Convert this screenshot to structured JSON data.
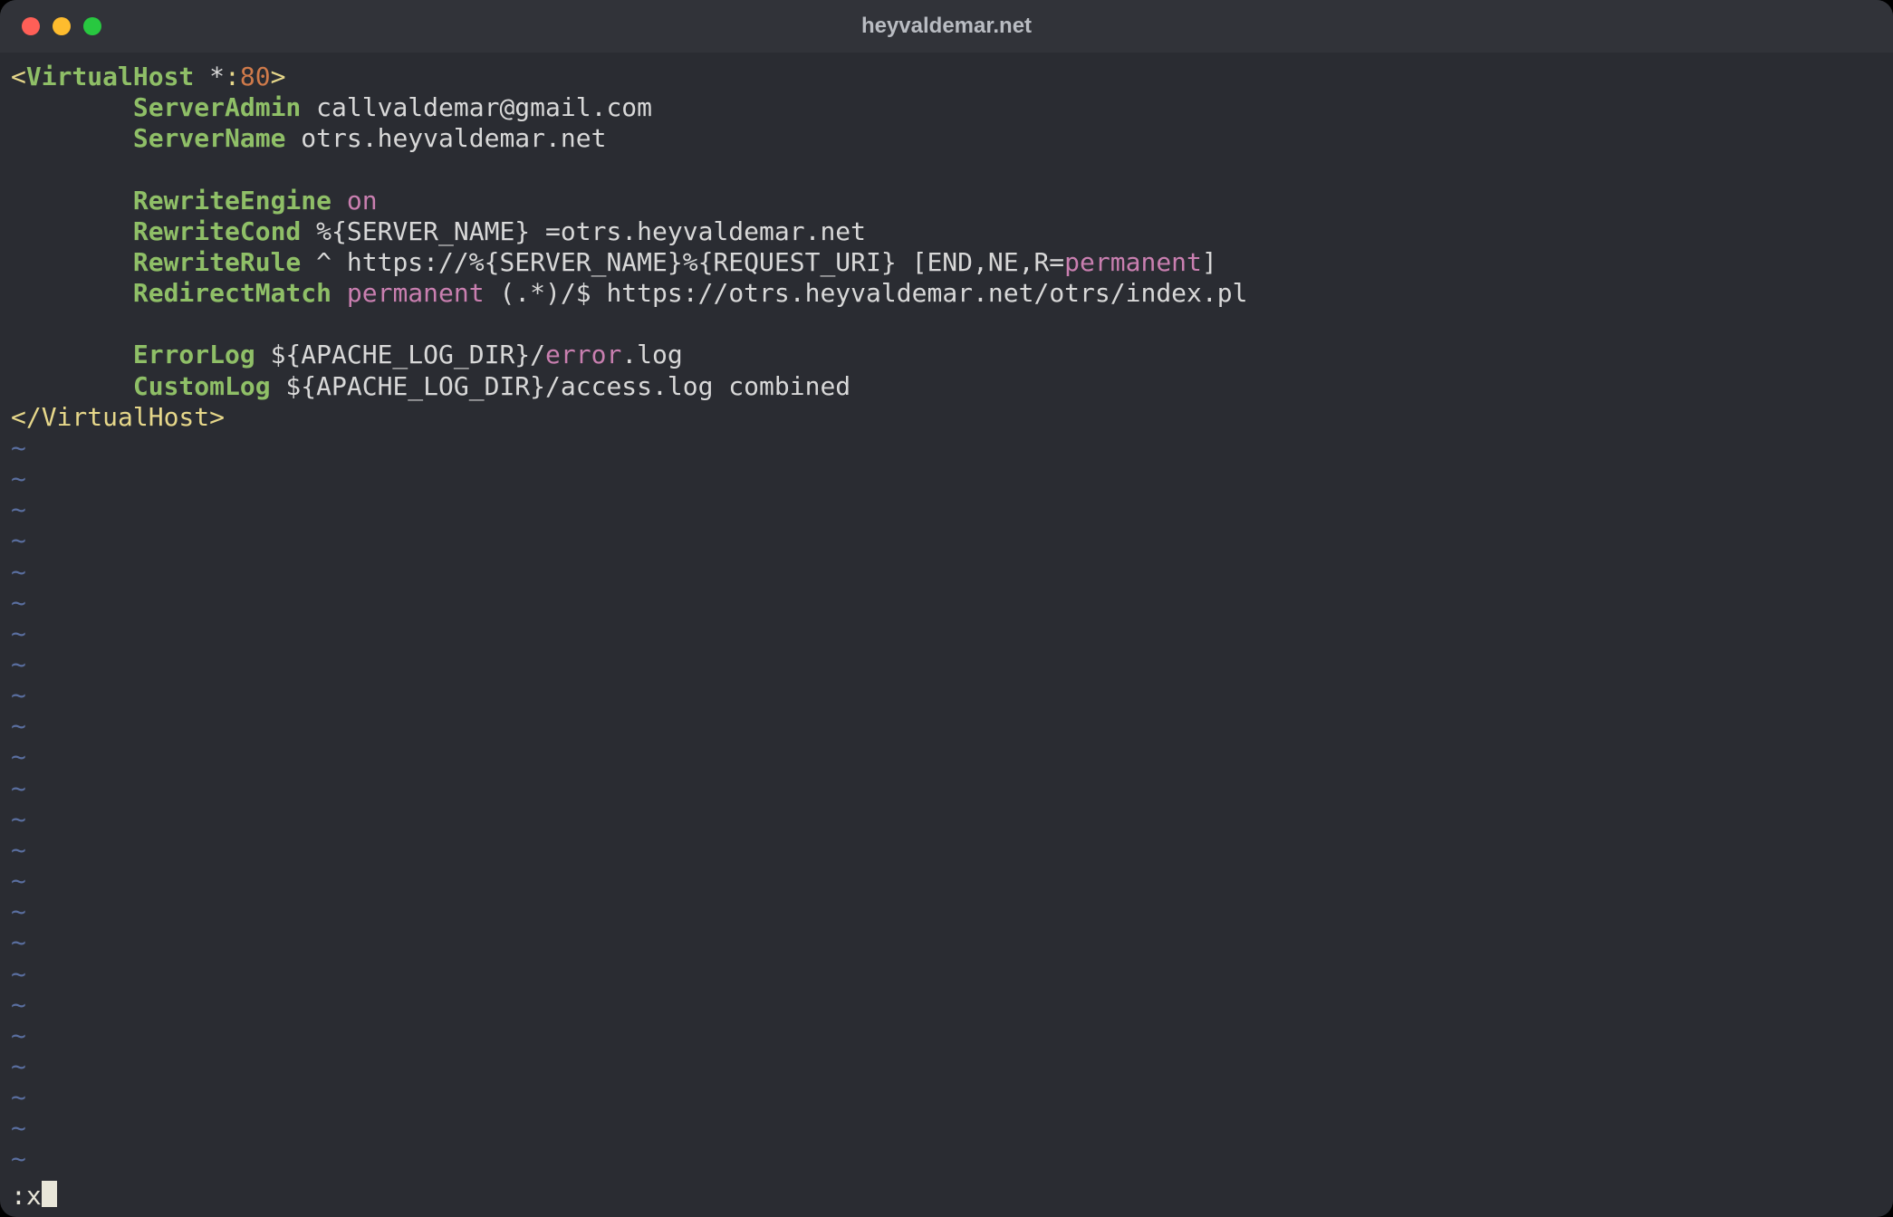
{
  "window": {
    "title": "heyvaldemar.net"
  },
  "colors": {
    "tag": "#e6d78a",
    "key": "#8fbf67",
    "val": "#c97fb0",
    "num": "#cf7a4a",
    "text": "#d8d8d8",
    "tilde": "#5a6fa0",
    "bg": "#2a2c32"
  },
  "vim": {
    "tilde": "~",
    "command_prefix": ":",
    "command_input": "x"
  },
  "config": {
    "open_tag_lt": "<",
    "open_tag_name": "VirtualHost ",
    "open_tag_host": "*",
    "open_tag_colon": ":",
    "open_tag_port": "80",
    "open_tag_gt": ">",
    "indent": "        ",
    "server_admin_key": "ServerAdmin",
    "server_admin_val": " callvaldemar@gmail.com",
    "server_name_key": "ServerName",
    "server_name_val": " otrs.heyvaldemar.net",
    "rewrite_engine_key": "RewriteEngine",
    "rewrite_engine_val": " on",
    "rewrite_cond_key": "RewriteCond",
    "rewrite_cond_val": " %{SERVER_NAME} =otrs.heyvaldemar.net",
    "rewrite_rule_key": "RewriteRule",
    "rewrite_rule_mid": " ^ https://%{SERVER_NAME}%{REQUEST_URI} [END,NE,R=",
    "rewrite_rule_perm": "permanent",
    "rewrite_rule_end": "]",
    "redirect_match_key": "RedirectMatch",
    "redirect_match_sp": " ",
    "redirect_match_perm": "permanent",
    "redirect_match_rest": " (.*)/$ https://otrs.heyvaldemar.net/otrs/index.pl",
    "error_log_key": "ErrorLog",
    "error_log_pre": " ${APACHE_LOG_DIR}/",
    "error_log_mid": "error",
    "error_log_post": ".log",
    "custom_log_key": "CustomLog",
    "custom_log_val": " ${APACHE_LOG_DIR}/access.log combined",
    "close_tag": "</VirtualHost>"
  }
}
